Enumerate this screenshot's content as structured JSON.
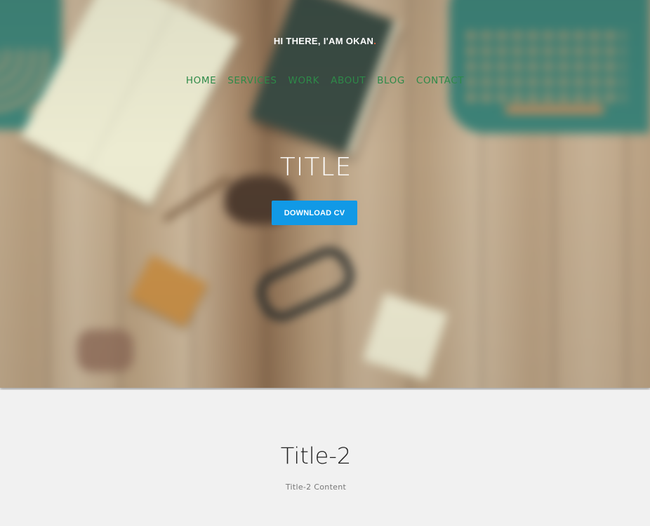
{
  "header": {
    "brand_text": "HI THERE, I'AM OKAN",
    "brand_dot": ".",
    "nav": [
      {
        "label": "HOME"
      },
      {
        "label": "SERVICES"
      },
      {
        "label": "WORK"
      },
      {
        "label": "ABOUT"
      },
      {
        "label": "BLOG"
      },
      {
        "label": "CONTACT"
      }
    ]
  },
  "hero": {
    "title": "TITLE",
    "button_label": "DOWNLOAD CV"
  },
  "section2": {
    "title": "Title-2",
    "content": "Title-2 Content"
  },
  "colors": {
    "nav_link": "#2e8a48",
    "brand_dot": "#e6603b",
    "button": "#1199e6",
    "page_bg": "#f1f1f1"
  }
}
